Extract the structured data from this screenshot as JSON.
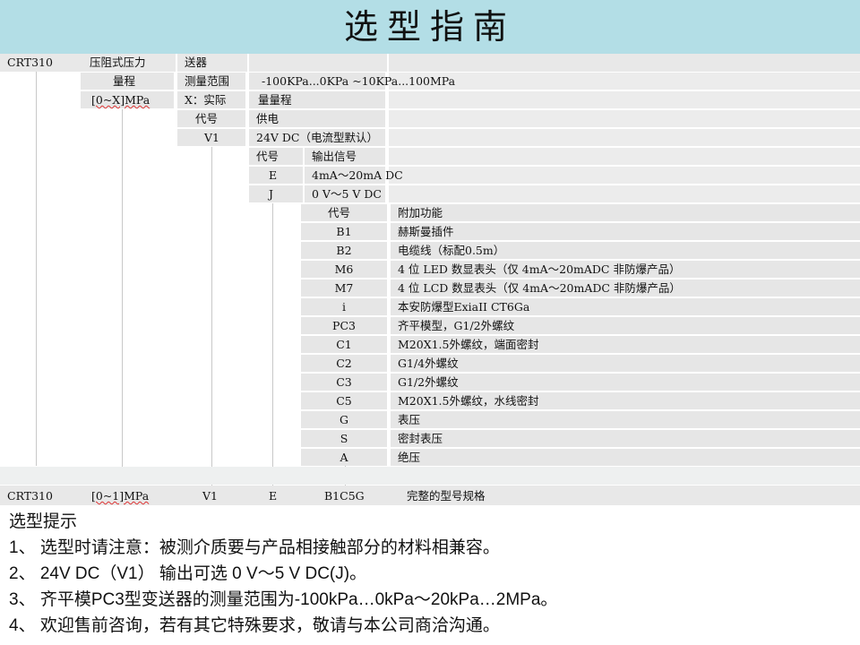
{
  "title": "选型指南",
  "header": {
    "model": "CRT310",
    "desc_1": "压阻式压力",
    "desc_2": "送器"
  },
  "range": {
    "label": "量程",
    "measure_label": "测量范围",
    "measure_value": "-100KPa...0KPa ~10KPa...100MPa",
    "unit": "[0~X]MPa",
    "x_label": "X：实际",
    "x_value": "量量程"
  },
  "supply": {
    "code_label": "代号",
    "label": "供电",
    "code": "V1",
    "value": "24V DC（电流型默认）"
  },
  "output": {
    "code_label": "代号",
    "label": "输出信号",
    "rows": [
      {
        "code": "E",
        "value": "4mA～20mA DC"
      },
      {
        "code": "J",
        "value": "0 V～5 V DC"
      }
    ]
  },
  "options": {
    "code_label": "代号",
    "label": "附加功能",
    "rows": [
      {
        "code": "B1",
        "value": "赫斯曼插件"
      },
      {
        "code": "B2",
        "value": "电缆线（标配0.5m）"
      },
      {
        "code": "M6",
        "value": "4 位 LED 数显表头（仅 4mA～20mADC 非防爆产品）"
      },
      {
        "code": "M7",
        "value": "4 位 LCD 数显表头（仅 4mA～20mADC 非防爆产品）"
      },
      {
        "code": "i",
        "value": "本安防爆型ExiaII CT6Ga"
      },
      {
        "code": "PC3",
        "value": "齐平模型，G1/2外螺纹"
      },
      {
        "code": "C1",
        "value": "M20X1.5外螺纹，端面密封"
      },
      {
        "code": "C2",
        "value": "G1/4外螺纹"
      },
      {
        "code": "C3",
        "value": "G1/2外螺纹"
      },
      {
        "code": "C5",
        "value": "M20X1.5外螺纹，水线密封"
      },
      {
        "code": "G",
        "value": "表压"
      },
      {
        "code": "S",
        "value": "密封表压"
      },
      {
        "code": "A",
        "value": "绝压"
      }
    ]
  },
  "example": {
    "model": "CRT310",
    "range": "[0~1]MPa",
    "supply": "V1",
    "output": "E",
    "options": "B1C5G",
    "label": "完整的型号规格"
  },
  "notes": {
    "heading": "选型提示",
    "items": [
      "1、 选型时请注意：被测介质要与产品相接触部分的材料相兼容。",
      "2、 24V DC（V1） 输出可选 0 V～5 V DC(J)。",
      "3、 齐平模PC3型变送器的测量范围为-100kPa…0kPa～20kPa…2MPa。",
      "4、 欢迎售前咨询，若有其它特殊要求，敬请与本公司商洽沟通。"
    ]
  }
}
